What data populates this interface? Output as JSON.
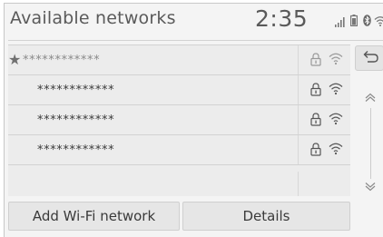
{
  "header": {
    "title": "Available networks",
    "clock": "2:35",
    "status_icons": [
      "signal-icon",
      "battery-icon",
      "bluetooth-icon",
      "wifi-status-icon"
    ]
  },
  "networks": [
    {
      "name": "************",
      "selected": true,
      "favorite_icon": "star-icon",
      "secured_icon": "lock-icon",
      "signal_icon": "wifi-icon"
    },
    {
      "name": "************",
      "selected": false,
      "secured_icon": "lock-icon",
      "signal_icon": "wifi-icon"
    },
    {
      "name": "************",
      "selected": false,
      "secured_icon": "lock-icon",
      "signal_icon": "wifi-icon"
    },
    {
      "name": "************",
      "selected": false,
      "secured_icon": "lock-icon",
      "signal_icon": "wifi-icon"
    }
  ],
  "side_controls": {
    "back_icon": "back-arrow-icon",
    "scroll_up_icon": "chevron-up-icon",
    "scroll_down_icon": "chevron-down-icon"
  },
  "buttons": {
    "add_network": "Add Wi-Fi network",
    "details": "Details"
  },
  "colors": {
    "background": "#f4f4f4",
    "list_background": "#ececec",
    "button_background": "#e6e6e6",
    "text": "#3a3a3a"
  }
}
